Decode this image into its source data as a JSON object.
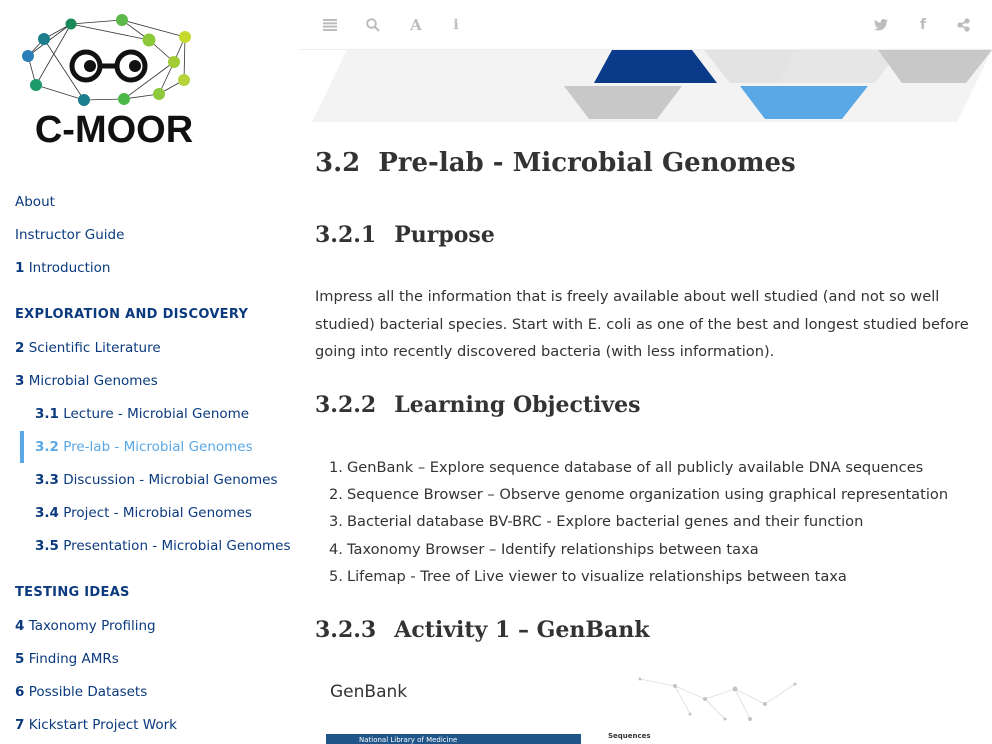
{
  "logo": {
    "text": "C-MOOR"
  },
  "toolbar": {
    "icons": [
      "menu-icon",
      "search-icon",
      "font-icon",
      "info-icon",
      "twitter-icon",
      "facebook-icon",
      "share-icon"
    ]
  },
  "sidebar": {
    "items": [
      {
        "num": "",
        "label": "About"
      },
      {
        "num": "",
        "label": "Instructor Guide"
      },
      {
        "num": "1",
        "label": "Introduction"
      }
    ],
    "section1": "EXPLORATION AND DISCOVERY",
    "items2": [
      {
        "num": "2",
        "label": "Scientific Literature"
      },
      {
        "num": "3",
        "label": "Microbial Genomes"
      }
    ],
    "subitems": [
      {
        "num": "3.1",
        "label": "Lecture - Microbial Genome"
      },
      {
        "num": "3.2",
        "label": "Pre-lab - Microbial Genomes"
      },
      {
        "num": "3.3",
        "label": "Discussion - Microbial Genomes"
      },
      {
        "num": "3.4",
        "label": "Project - Microbial Genomes"
      },
      {
        "num": "3.5",
        "label": "Presentation - Microbial Genomes"
      }
    ],
    "section2": "TESTING IDEAS",
    "items3": [
      {
        "num": "4",
        "label": "Taxonomy Profiling"
      },
      {
        "num": "5",
        "label": "Finding AMRs"
      },
      {
        "num": "6",
        "label": "Possible Datasets"
      },
      {
        "num": "7",
        "label": "Kickstart Project Work"
      }
    ]
  },
  "main": {
    "title_num": "3.2",
    "title": "Pre-lab - Microbial Genomes",
    "purpose_num": "3.2.1",
    "purpose": "Purpose",
    "purpose_text": "Impress all the information that is freely available about well studied (and not so well studied) bacterial species. Start with E. coli as one of the best and longest studied before going into recently discovered bacteria (with less information).",
    "objectives_num": "3.2.2",
    "objectives": "Learning Objectives",
    "objective_items": [
      "GenBank – Explore sequence database of all publicly available DNA sequences",
      "Sequence Browser – Observe genome organization using graphical representation",
      "Bacterial database BV-BRC - Explore bacterial genes and their function",
      "Taxonomy Browser – Identify relationships between taxa",
      "Lifemap - Tree of Live viewer to visualize relationships between taxa"
    ],
    "activity_num": "3.2.3",
    "activity": "Activity 1 – GenBank",
    "figure": {
      "label": "GenBank",
      "bar_text": "National Library of Medicine",
      "seq_text": "Sequences"
    }
  },
  "colors": {
    "nav": "#0b3a7e",
    "active": "#5aa8e6",
    "banner_dark": "#0a3a8a",
    "banner_light": "#5aa8e6",
    "banner_gray": "#c8c8c8"
  }
}
